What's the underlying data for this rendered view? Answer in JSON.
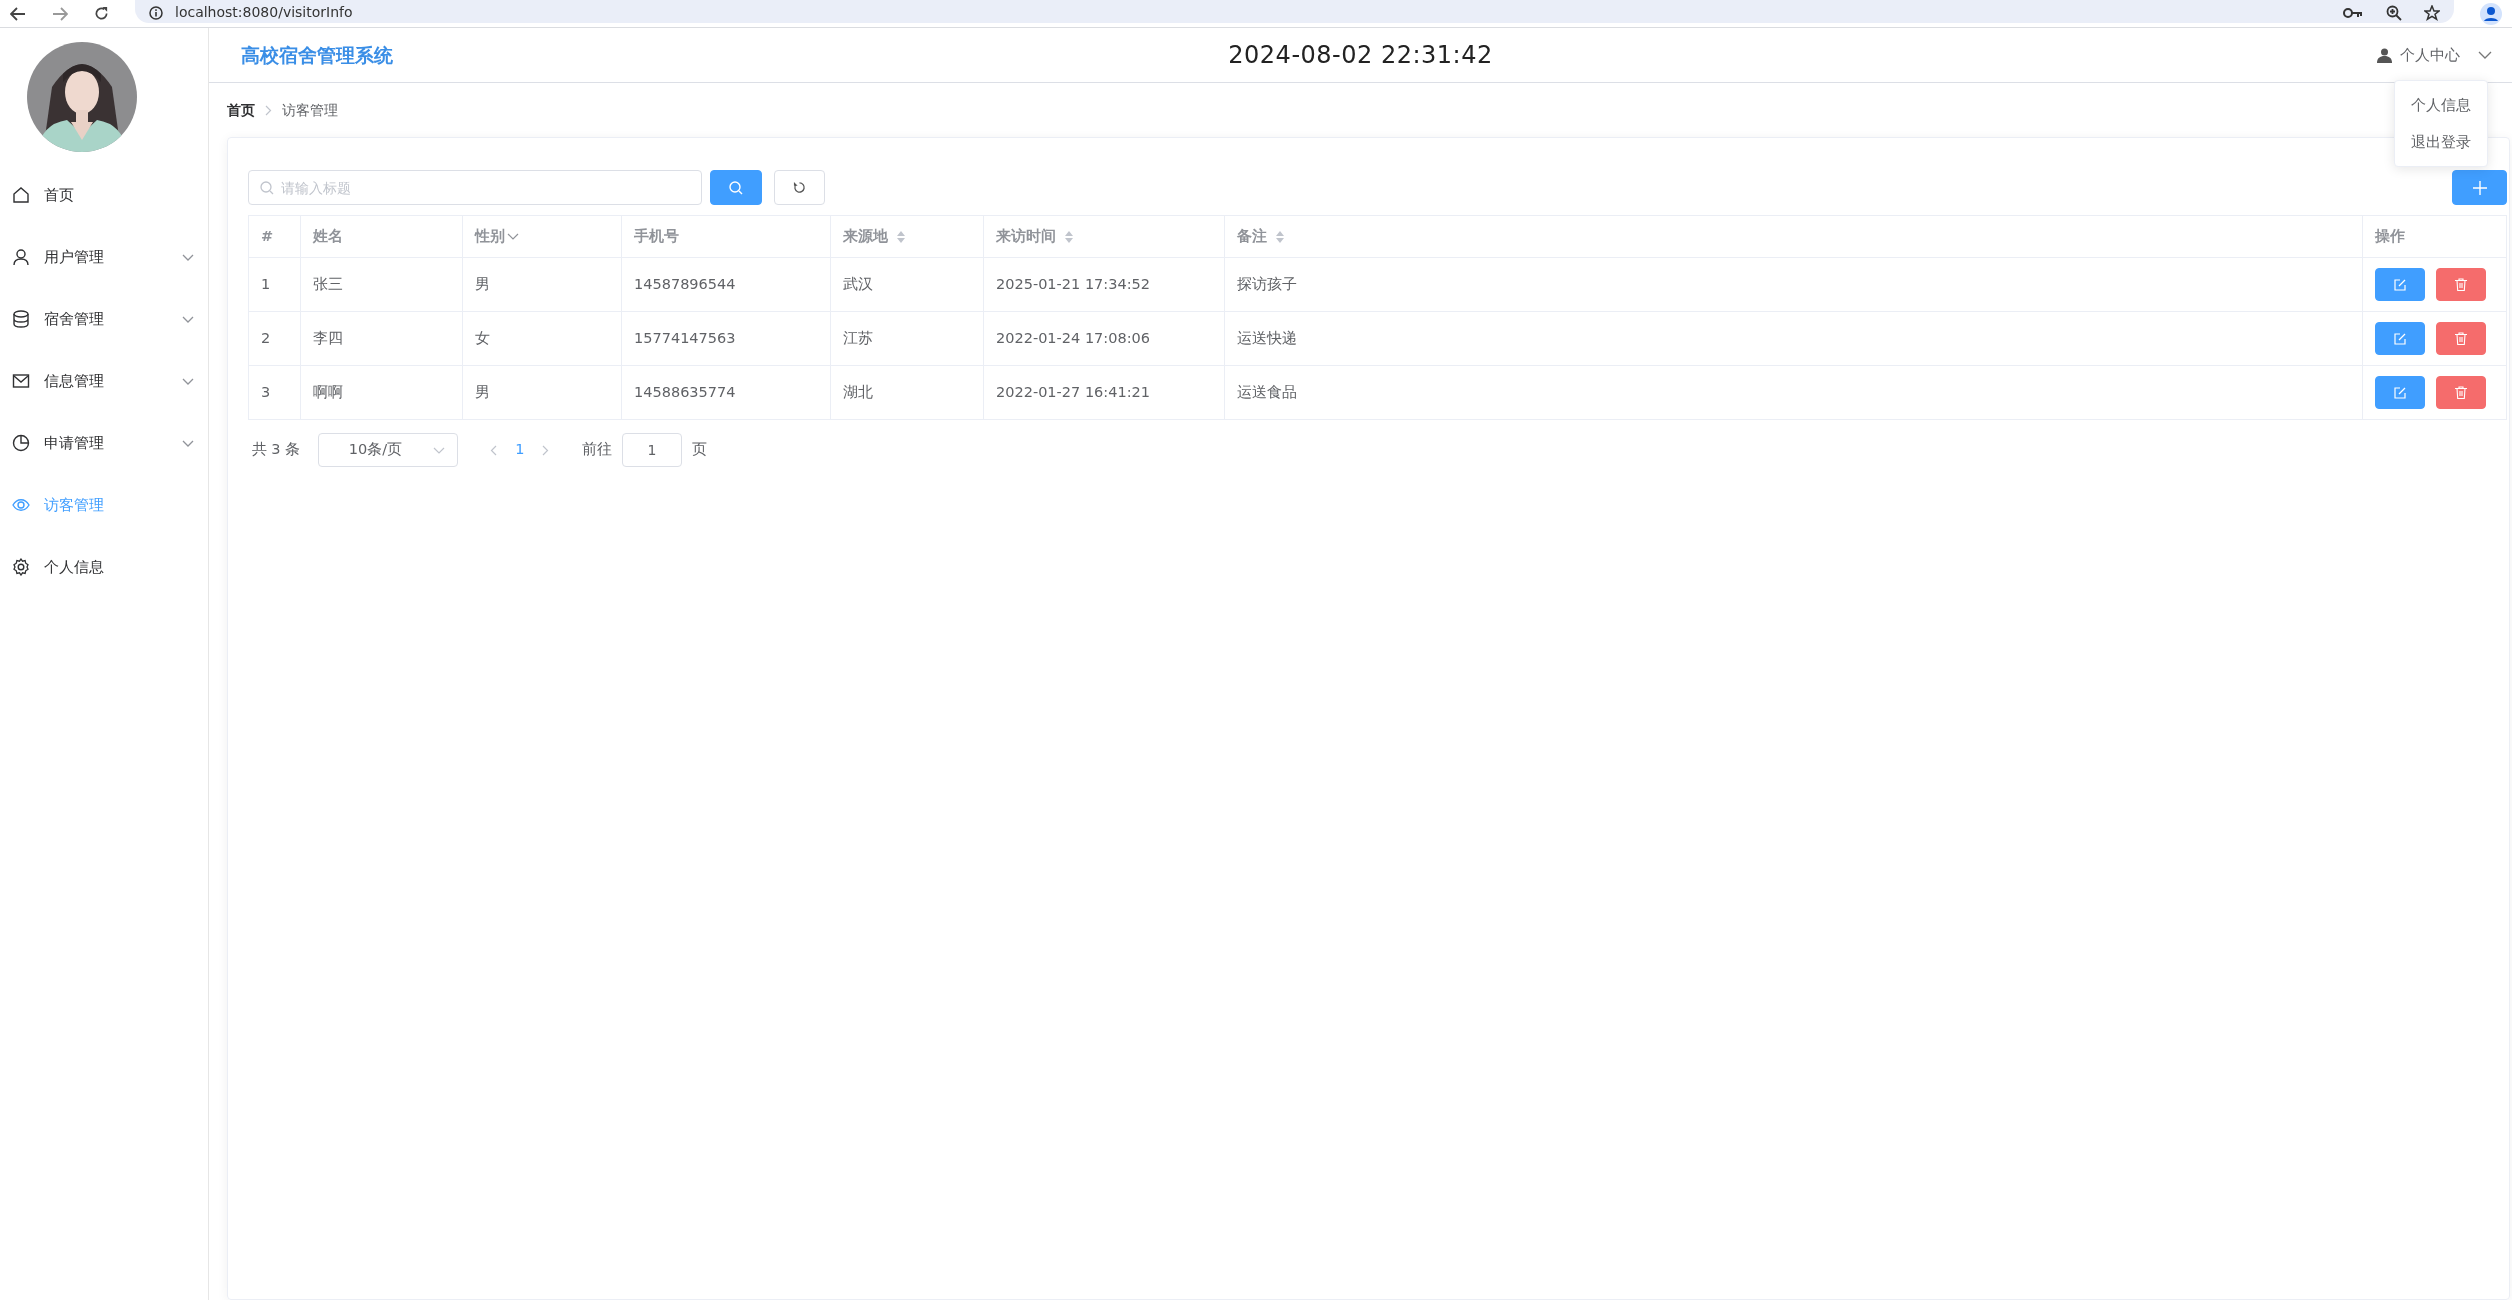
{
  "browser": {
    "url": "localhost:8080/visitorInfo"
  },
  "sidebar": {
    "items": [
      {
        "label": "首页",
        "has_submenu": false,
        "selected": false
      },
      {
        "label": "用户管理",
        "has_submenu": true,
        "selected": false
      },
      {
        "label": "宿舍管理",
        "has_submenu": true,
        "selected": false
      },
      {
        "label": "信息管理",
        "has_submenu": true,
        "selected": false
      },
      {
        "label": "申请管理",
        "has_submenu": true,
        "selected": false
      },
      {
        "label": "访客管理",
        "has_submenu": false,
        "selected": true
      },
      {
        "label": "个人信息",
        "has_submenu": false,
        "selected": false
      }
    ]
  },
  "header": {
    "title": "高校宿舍管理系统",
    "clock": "2024-08-02 22:31:42",
    "user_menu": "个人中心"
  },
  "dropdown": {
    "items": [
      "个人信息",
      "退出登录"
    ]
  },
  "breadcrumb": [
    {
      "label": "首页",
      "link": true
    },
    {
      "label": "访客管理",
      "link": false
    }
  ],
  "search": {
    "placeholder": "请输入标题"
  },
  "table": {
    "columns": [
      {
        "label": "#",
        "kind": "plain"
      },
      {
        "label": "姓名",
        "kind": "plain"
      },
      {
        "label": "性别",
        "kind": "filter"
      },
      {
        "label": "手机号",
        "kind": "plain"
      },
      {
        "label": "来源地",
        "kind": "sort"
      },
      {
        "label": "来访时间",
        "kind": "sort"
      },
      {
        "label": "备注",
        "kind": "sort"
      },
      {
        "label": "操作",
        "kind": "plain"
      }
    ],
    "rows": [
      {
        "cells": [
          "1",
          "张三",
          "男",
          "14587896544",
          "武汉",
          "2025-01-21 17:34:52",
          "探访孩子"
        ]
      },
      {
        "cells": [
          "2",
          "李四",
          "女",
          "15774147563",
          "江苏",
          "2022-01-24 17:08:06",
          "运送快递"
        ]
      },
      {
        "cells": [
          "3",
          "啊啊",
          "男",
          "14588635774",
          "湖北",
          "2022-01-27 16:41:21",
          "运送食品"
        ]
      }
    ]
  },
  "pagination": {
    "total": "共 3 条",
    "page_size": "10条/页",
    "pages": [
      {
        "label": "1",
        "selected": true
      }
    ],
    "goto_label": "前往",
    "goto_value": "1",
    "page_unit": "页"
  }
}
